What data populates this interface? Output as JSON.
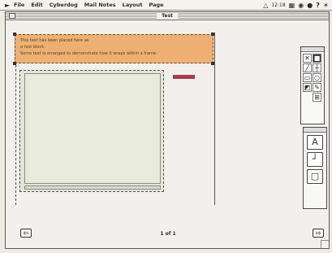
{
  "menubar": {
    "apple_icon": "apple-icon",
    "items": [
      "File",
      "Edit",
      "Cyberdog",
      "Mail Notes",
      "Layout",
      "Page"
    ],
    "clock": "12:18"
  },
  "window": {
    "title": "Test"
  },
  "text_frame": {
    "lines": [
      "This text has been placed here as",
      "a test block.",
      "Some text is arranged to demonstrate how it wraps within a frame."
    ]
  },
  "page": {
    "number_label": "1 of 1"
  },
  "nav": {
    "prev_icon": "left-arrow-icon",
    "next_icon": "right-arrow-icon",
    "prev_glyph": "⇦",
    "next_glyph": "⇨"
  },
  "tools": {
    "glyphs": [
      "✕",
      "■",
      "╱",
      "┼",
      "▭",
      "○",
      "◩",
      "✎",
      "",
      "⊞"
    ],
    "big_glyphs": [
      "A",
      "┘",
      "▢"
    ]
  },
  "colors": {
    "text_frame_fill": "#eeb072",
    "picture_fill": "#e8ebdc",
    "accent_chip": "#b2394a"
  }
}
